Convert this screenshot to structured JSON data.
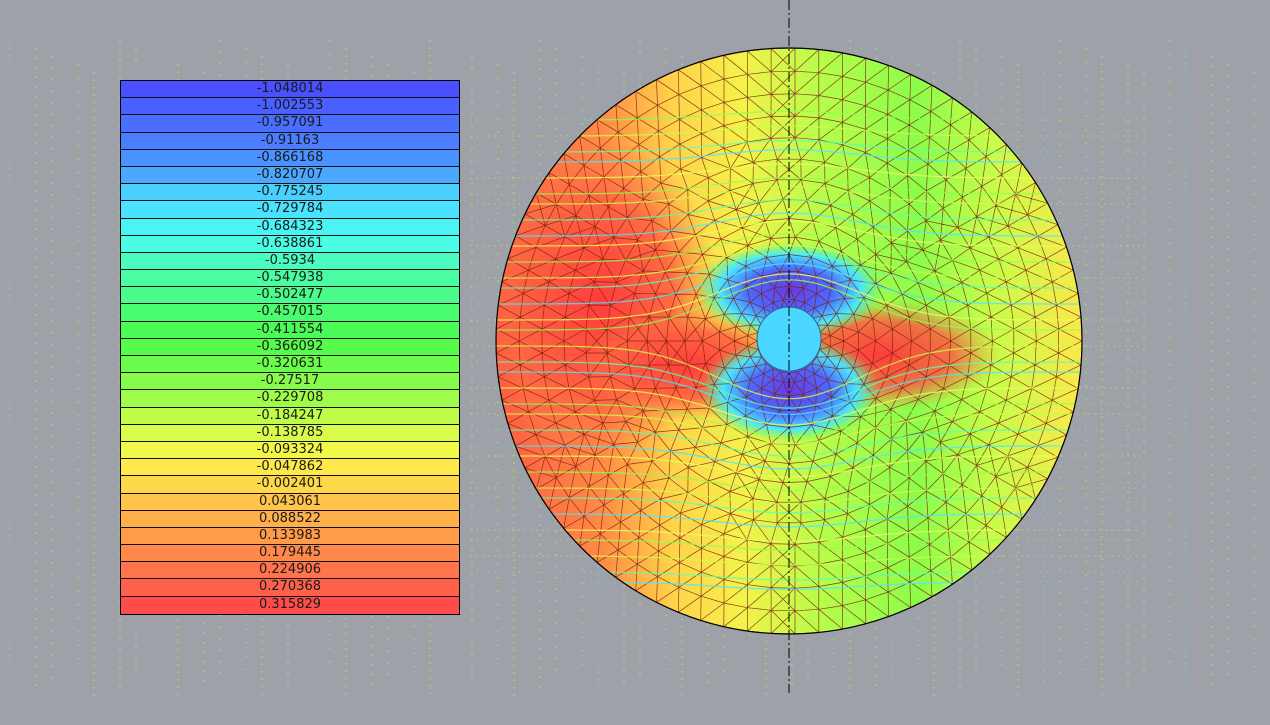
{
  "legend": {
    "entries": [
      {
        "value": "-1.048014",
        "color": "#4a50ff"
      },
      {
        "value": "-1.002553",
        "color": "#4a5fff"
      },
      {
        "value": "-0.957091",
        "color": "#4a6eff"
      },
      {
        "value": "-0.91163",
        "color": "#4a7dff"
      },
      {
        "value": "-0.866168",
        "color": "#4a92ff"
      },
      {
        "value": "-0.820707",
        "color": "#4aa8ff"
      },
      {
        "value": "-0.775245",
        "color": "#4ad0ff"
      },
      {
        "value": "-0.729784",
        "color": "#4ae2ff"
      },
      {
        "value": "-0.684323",
        "color": "#4af4f4"
      },
      {
        "value": "-0.638861",
        "color": "#4afde4"
      },
      {
        "value": "-0.5934",
        "color": "#4afcc0"
      },
      {
        "value": "-0.547938",
        "color": "#4afca2"
      },
      {
        "value": "-0.502477",
        "color": "#4afc8a"
      },
      {
        "value": "-0.457015",
        "color": "#4afc70"
      },
      {
        "value": "-0.411554",
        "color": "#4afc55"
      },
      {
        "value": "-0.366092",
        "color": "#55fc4a"
      },
      {
        "value": "-0.320631",
        "color": "#6afc4a"
      },
      {
        "value": "-0.27517",
        "color": "#85fc4a"
      },
      {
        "value": "-0.229708",
        "color": "#a0fc4a"
      },
      {
        "value": "-0.184247",
        "color": "#c0fc4a"
      },
      {
        "value": "-0.138785",
        "color": "#d8fc4a"
      },
      {
        "value": "-0.093324",
        "color": "#f2f84a"
      },
      {
        "value": "-0.047862",
        "color": "#ffe84a"
      },
      {
        "value": "-0.002401",
        "color": "#ffd84a"
      },
      {
        "value": "0.043061",
        "color": "#ffc44a"
      },
      {
        "value": "0.088522",
        "color": "#ffb04a"
      },
      {
        "value": "0.133983",
        "color": "#ff9c4a"
      },
      {
        "value": "0.179445",
        "color": "#ff884a"
      },
      {
        "value": "0.224906",
        "color": "#ff744a"
      },
      {
        "value": "0.270368",
        "color": "#ff604a"
      },
      {
        "value": "0.315829",
        "color": "#ff4c4a"
      }
    ]
  },
  "colors": {
    "background": "#9ea2a8",
    "mesh_line": "#7a1f10",
    "axis_line": "#000000",
    "streamline": "#8cff50"
  }
}
